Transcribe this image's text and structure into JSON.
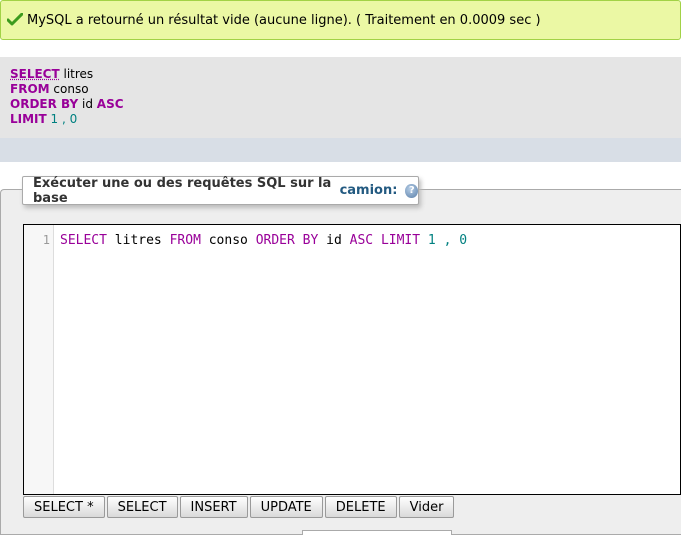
{
  "message": {
    "text": "MySQL a retourné un résultat vide (aucune ligne). ( Traitement en 0.0009 sec )"
  },
  "query_display": {
    "line1": {
      "kw": "SELECT",
      "rest": " litres"
    },
    "line2": {
      "kw": "FROM",
      "rest": " conso"
    },
    "line3": {
      "kw": "ORDER BY",
      "mid": " id ",
      "kw2": "ASC"
    },
    "line4": {
      "kw": "LIMIT",
      "n1": "1",
      "sep": " , ",
      "n2": "0"
    }
  },
  "sql_panel": {
    "legend_text": "Exécuter une ou des requêtes SQL sur la base",
    "database": "camion:",
    "help_icon": "?"
  },
  "editor": {
    "line_number": "1",
    "tokens": [
      {
        "t": "SELECT",
        "cls": "kw"
      },
      {
        "t": " litres ",
        "cls": "id"
      },
      {
        "t": "FROM",
        "cls": "kw"
      },
      {
        "t": " conso ",
        "cls": "id"
      },
      {
        "t": "ORDER BY",
        "cls": "kw"
      },
      {
        "t": " id ",
        "cls": "id"
      },
      {
        "t": "ASC",
        "cls": "kw"
      },
      {
        "t": " ",
        "cls": "id"
      },
      {
        "t": "LIMIT",
        "cls": "kw"
      },
      {
        "t": " ",
        "cls": "id"
      },
      {
        "t": "1",
        "cls": "num"
      },
      {
        "t": " , ",
        "cls": "num"
      },
      {
        "t": "0",
        "cls": "num"
      }
    ]
  },
  "buttons": {
    "select_star": "SELECT *",
    "select": "SELECT",
    "insert": "INSERT",
    "update": "UPDATE",
    "delete": "DELETE",
    "clear": "Vider"
  },
  "colors": {
    "success_bg": "#ebf8a4",
    "keyword": "#990099",
    "number": "#008080",
    "db_name": "#235a81"
  }
}
